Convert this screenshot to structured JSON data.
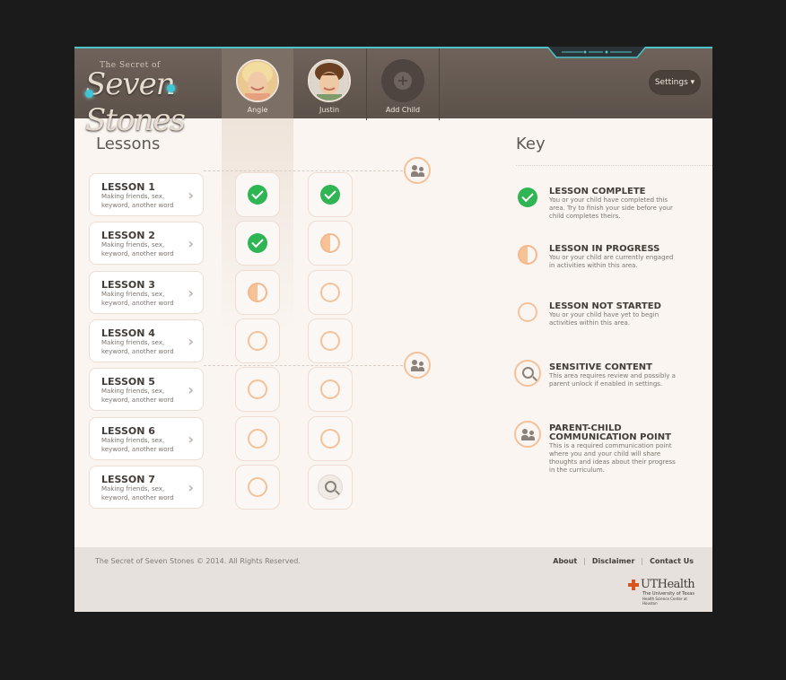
{
  "header": {
    "logo": {
      "small": "The Secret of",
      "big": "Seven Stones"
    },
    "profiles": [
      {
        "name": "Angie"
      },
      {
        "name": "Justin"
      },
      {
        "name": "Add Child"
      }
    ],
    "settings_label": "Settings ▾"
  },
  "lessons": {
    "title": "Lessons",
    "items": [
      {
        "title": "LESSON 1",
        "desc": "Making friends, sex, keyword, another word",
        "status": [
          "complete",
          "complete"
        ]
      },
      {
        "title": "LESSON 2",
        "desc": "Making friends, sex, keyword, another word",
        "status": [
          "complete",
          "progress"
        ]
      },
      {
        "title": "LESSON 3",
        "desc": "Making friends, sex, keyword, another word",
        "status": [
          "progress",
          "notstarted"
        ]
      },
      {
        "title": "LESSON 4",
        "desc": "Making friends, sex, keyword, another word",
        "status": [
          "notstarted",
          "notstarted"
        ]
      },
      {
        "title": "LESSON 5",
        "desc": "Making friends, sex, keyword, another word",
        "status": [
          "notstarted",
          "notstarted"
        ]
      },
      {
        "title": "LESSON 6",
        "desc": "Making friends, sex, keyword, another word",
        "status": [
          "notstarted",
          "notstarted"
        ]
      },
      {
        "title": "LESSON 7",
        "desc": "Making friends, sex, keyword, another word",
        "status": [
          "notstarted",
          "sensitive"
        ]
      }
    ]
  },
  "key": {
    "title": "Key",
    "items": [
      {
        "icon": "complete",
        "title": "LESSON COMPLETE",
        "desc": "You or your child have completed this area. Try to finish your side before your child completes theirs."
      },
      {
        "icon": "progress",
        "title": "LESSON IN PROGRESS",
        "desc": "You or your child are currently engaged in activities within this area."
      },
      {
        "icon": "notstarted",
        "title": "LESSON NOT STARTED",
        "desc": "You or your child have yet to begin activities within this area."
      },
      {
        "icon": "sensitive",
        "title": "SENSITIVE CONTENT",
        "desc": "This area requires review and possibly a parent unlock if enabled in settings."
      },
      {
        "icon": "communication",
        "title": "PARENT-CHILD COMMUNICATION POINT",
        "desc": "This is a required communication point where you and your child will share thoughts and ideas about their progress in the curriculum."
      }
    ]
  },
  "footer": {
    "copyright": "The Secret of Seven Stones © 2014. All Rights Reserved.",
    "links": [
      "About",
      "Disclaimer",
      "Contact Us"
    ],
    "uthealth": {
      "name": "UTHealth",
      "sub1": "The University of Texas",
      "sub2": "Health Science Center at Houston"
    }
  },
  "colors": {
    "complete": "#2fb553",
    "progress": "#f7c296",
    "accent": "#4cc3c9",
    "header": "#5d524b"
  }
}
